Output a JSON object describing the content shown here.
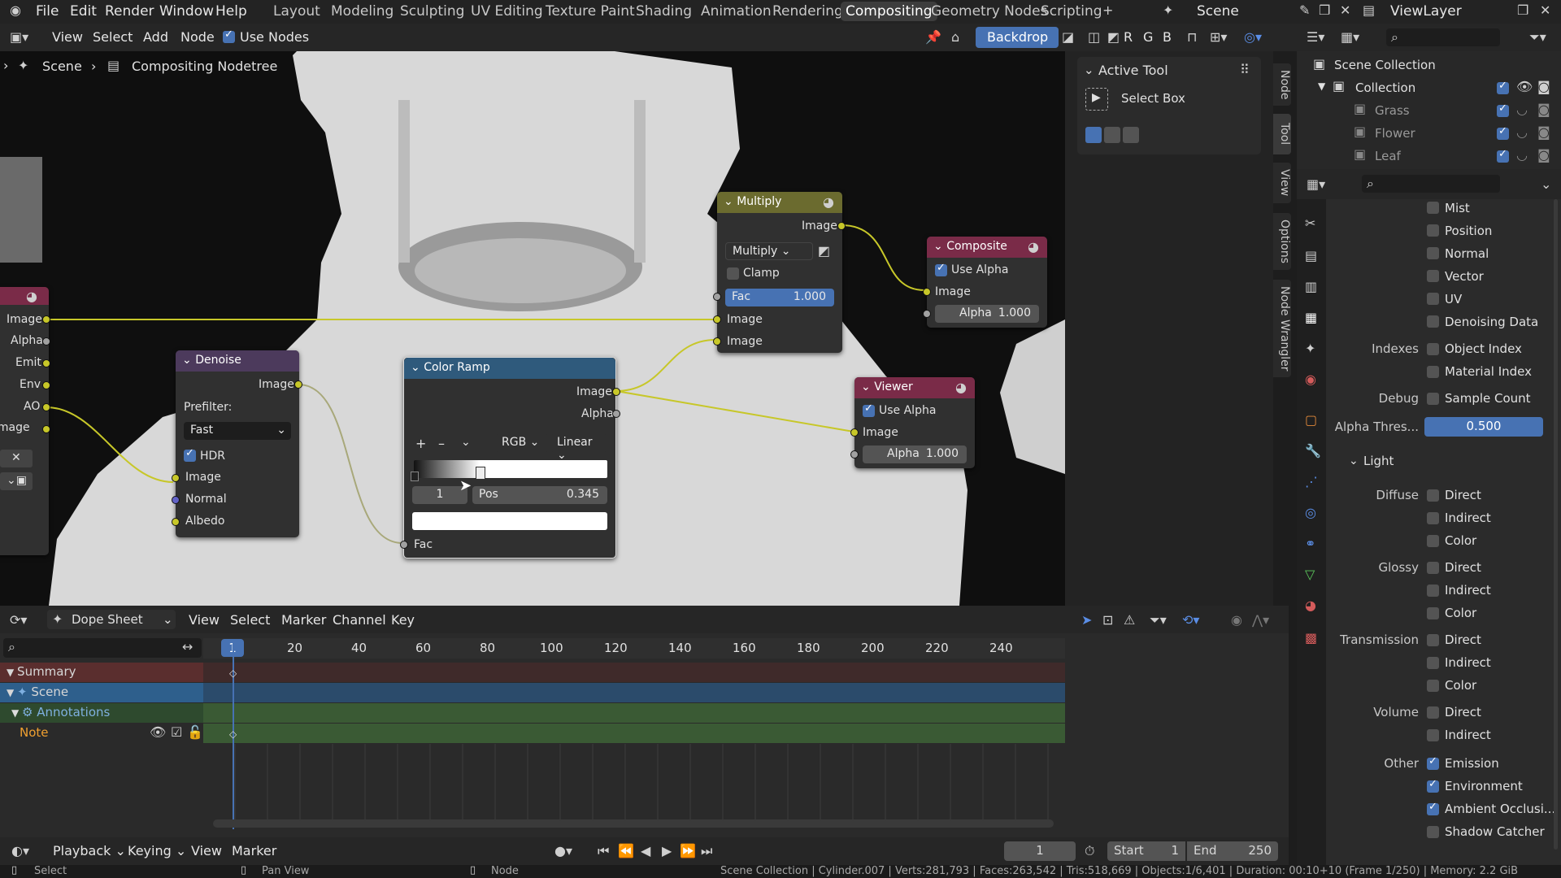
{
  "topbar": {
    "menus": [
      "File",
      "Edit",
      "Render",
      "Window",
      "Help"
    ],
    "workspaces": [
      "Layout",
      "Modeling",
      "Sculpting",
      "UV Editing",
      "Texture Paint",
      "Shading",
      "Animation",
      "Rendering",
      "Compositing",
      "Geometry Nodes",
      "Scripting"
    ],
    "active_workspace": "Compositing",
    "scene": "Scene",
    "view_layer": "ViewLayer"
  },
  "editor_header": {
    "view": "View",
    "select": "Select",
    "add": "Add",
    "node": "Node",
    "use_nodes": "Use Nodes",
    "backdrop": "Backdrop",
    "channels": [
      "R",
      "G",
      "B"
    ]
  },
  "breadcrumb": {
    "scene": "Scene",
    "tree": "Compositing Nodetree"
  },
  "render_layers_node": {
    "sockets": [
      "Image",
      "Alpha",
      "Emit",
      "Env",
      "AO",
      "y Image"
    ]
  },
  "denoise_node": {
    "title": "Denoise",
    "out": "Image",
    "prefilter_label": "Prefilter:",
    "prefilter": "Fast",
    "hdr": "HDR",
    "inputs": [
      "Image",
      "Normal",
      "Albedo"
    ]
  },
  "colorramp_node": {
    "title": "Color Ramp",
    "outputs": [
      "Image",
      "Alpha"
    ],
    "color_mode": "RGB",
    "interp": "Linear",
    "index": "1",
    "pos_label": "Pos",
    "pos": "0.345",
    "input": "Fac"
  },
  "multiply_node": {
    "title": "Multiply",
    "out": "Image",
    "blend": "Multiply",
    "clamp": "Clamp",
    "fac_label": "Fac",
    "fac": "1.000",
    "inputs": [
      "Image",
      "Image"
    ]
  },
  "composite_node": {
    "title": "Composite",
    "use_alpha": "Use Alpha",
    "image": "Image",
    "alpha_label": "Alpha",
    "alpha": "1.000"
  },
  "viewer_node": {
    "title": "Viewer",
    "use_alpha": "Use Alpha",
    "image": "Image",
    "alpha_label": "Alpha",
    "alpha": "1.000"
  },
  "tool_panel": {
    "title": "Active Tool",
    "tool": "Select Box"
  },
  "side_tabs": [
    "Node",
    "Tool",
    "View",
    "Options",
    "Node Wrangler"
  ],
  "outliner": {
    "root": "Scene Collection",
    "collection": "Collection",
    "items": [
      "Grass",
      "Flower",
      "Leaf"
    ]
  },
  "props": {
    "passes": [
      "Mist",
      "Position",
      "Normal",
      "Vector",
      "UV",
      "Denoising Data"
    ],
    "indexes_label": "Indexes",
    "indexes": [
      "Object Index",
      "Material Index"
    ],
    "debug_label": "Debug",
    "debug": "Sample Count",
    "alpha_thres_label": "Alpha Thres...",
    "alpha_thres": "0.500",
    "light": "Light",
    "diffuse": "Diffuse",
    "glossy": "Glossy",
    "transmission": "Transmission",
    "volume": "Volume",
    "other": "Other",
    "direct": "Direct",
    "indirect": "Indirect",
    "color": "Color",
    "other_items": [
      "Emission",
      "Environment",
      "Ambient Occlusi...",
      "Shadow Catcher"
    ]
  },
  "dopesheet": {
    "mode": "Dope Sheet",
    "menus": [
      "View",
      "Select",
      "Marker",
      "Channel",
      "Key"
    ],
    "ruler": [
      "1",
      "20",
      "40",
      "60",
      "80",
      "100",
      "120",
      "140",
      "160",
      "180",
      "200",
      "220",
      "240"
    ],
    "channels": [
      "Summary",
      "Scene",
      "Annotations",
      "Note"
    ]
  },
  "timeline": {
    "playback": "Playback",
    "keying": "Keying",
    "view": "View",
    "marker": "Marker",
    "frame": "1",
    "start_label": "Start",
    "start": "1",
    "end_label": "End",
    "end": "250"
  },
  "status": {
    "select": "Select",
    "pan": "Pan View",
    "node": "Node",
    "info": "Scene Collection | Cylinder.007 | Verts:281,793 | Faces:263,542 | Tris:518,669 | Objects:1/6,401 | Duration: 00:10+10 (Frame 1/250) | Memory: 2.2 GiB"
  }
}
